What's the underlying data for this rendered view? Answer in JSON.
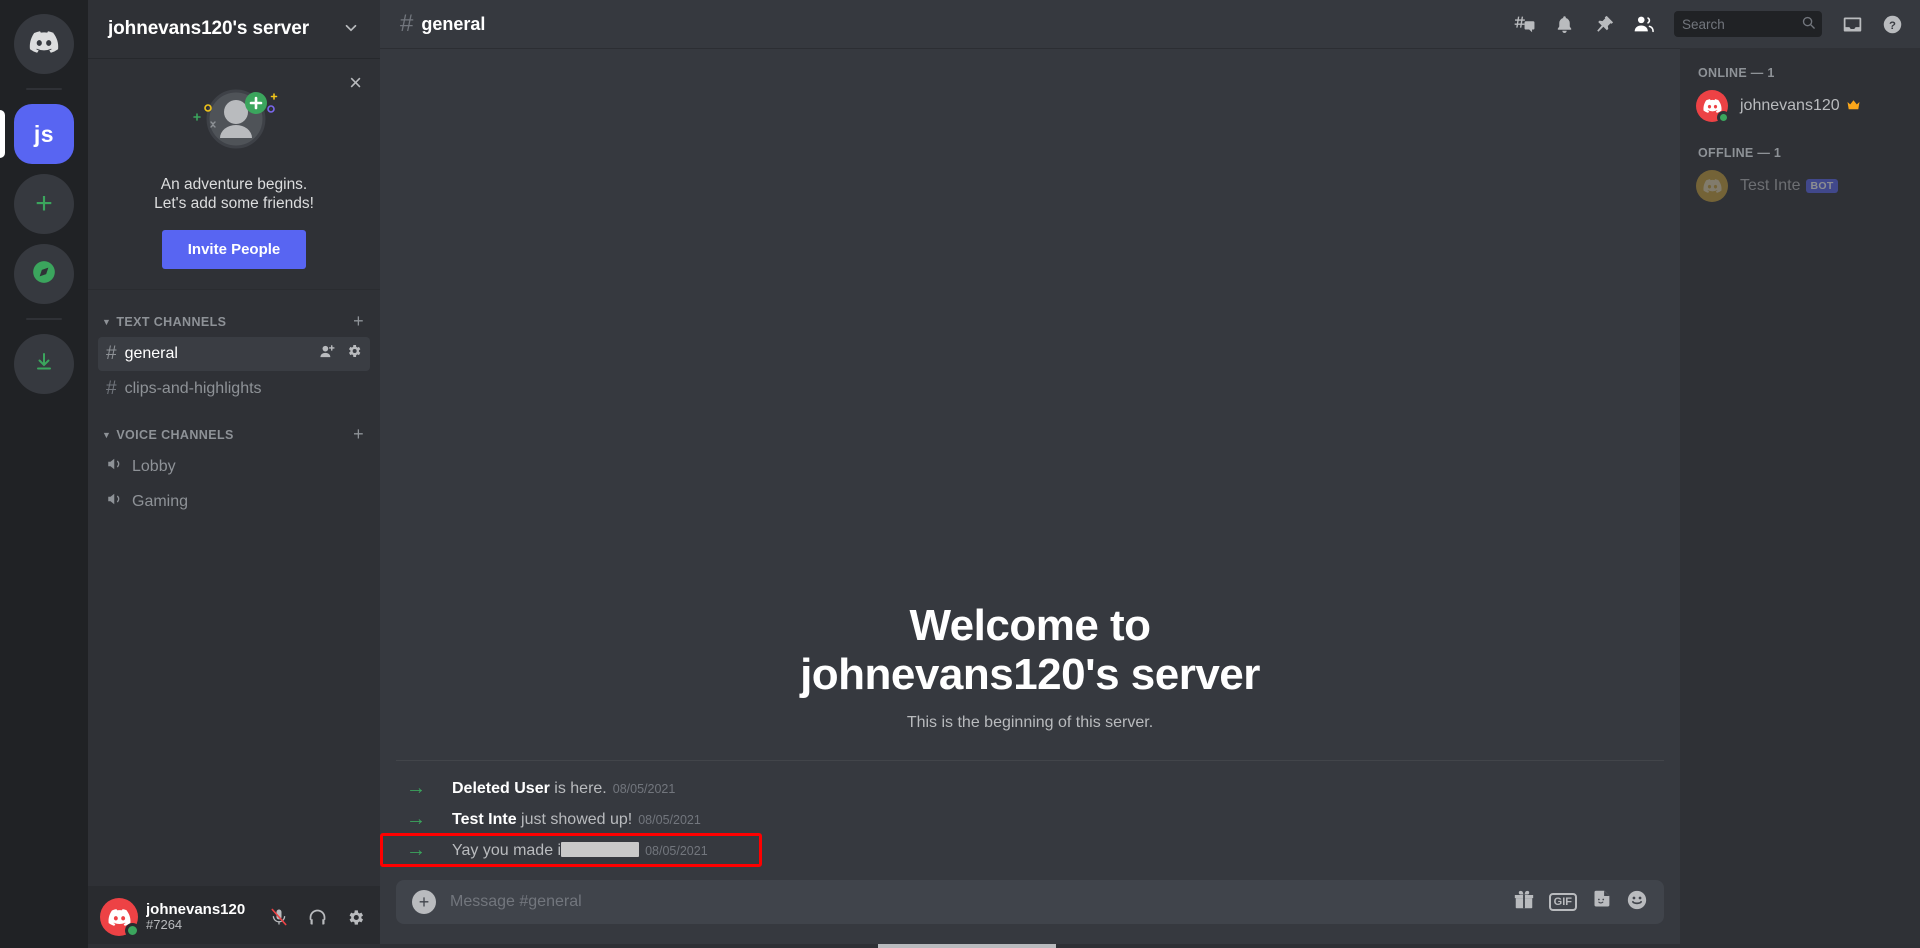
{
  "rail": {
    "items": [
      {
        "name": "discord-home",
        "label": "",
        "icon": "discord-logo-icon",
        "active": false
      },
      {
        "name": "server-js",
        "label": "js",
        "icon": "server-initials",
        "active": true
      },
      {
        "name": "add-server",
        "label": "+",
        "icon": "plus-icon",
        "active": false
      },
      {
        "name": "explore-servers",
        "label": "",
        "icon": "compass-icon",
        "active": false
      },
      {
        "name": "download-apps",
        "label": "",
        "icon": "download-icon",
        "active": false
      }
    ]
  },
  "sidebar": {
    "server_name": "johnevans120's server",
    "promo": {
      "line1": "An adventure begins.",
      "line2": "Let's add some friends!",
      "button": "Invite People",
      "close": "×"
    },
    "categories": [
      {
        "label": "TEXT CHANNELS",
        "plus": "+",
        "channels": [
          {
            "name": "general",
            "type": "text",
            "active": true
          },
          {
            "name": "clips-and-highlights",
            "type": "text",
            "active": false
          }
        ]
      },
      {
        "label": "VOICE CHANNELS",
        "plus": "+",
        "channels": [
          {
            "name": "Lobby",
            "type": "voice",
            "active": false
          },
          {
            "name": "Gaming",
            "type": "voice",
            "active": false
          }
        ]
      }
    ],
    "user": {
      "username": "johnevans120",
      "discriminator": "#7264",
      "status": "online",
      "controls": [
        "mic-muted-icon",
        "headphones-icon",
        "user-settings-gear-icon"
      ]
    }
  },
  "topbar": {
    "channel_name": "general",
    "hash": "#",
    "icons": [
      "threads-icon",
      "notification-bell-icon",
      "pinned-messages-icon",
      "member-list-icon"
    ],
    "search_placeholder": "Search",
    "right_icons": [
      "inbox-icon",
      "help-icon"
    ]
  },
  "main": {
    "welcome_line1": "Welcome to",
    "welcome_line2": "johnevans120's server",
    "subtitle": "This is the beginning of this server.",
    "system_messages": [
      {
        "actor": "Deleted User",
        "text": " is here.",
        "timestamp": "08/05/2021",
        "redacted": false,
        "highlighted": false
      },
      {
        "actor": "Test Inte",
        "text": " just showed up!",
        "timestamp": "08/05/2021",
        "redacted": false,
        "highlighted": false
      },
      {
        "actor": "",
        "text": "Yay you made i",
        "timestamp": "08/05/2021",
        "redacted": true,
        "highlighted": true
      }
    ],
    "composer_placeholder": "Message #general",
    "composer_icons": [
      "gift-icon",
      "gif-icon",
      "sticker-icon",
      "emoji-icon"
    ],
    "gif_label": "GIF"
  },
  "members": {
    "online_header": "ONLINE — 1",
    "offline_header": "OFFLINE — 1",
    "online": [
      {
        "name": "johnevans120",
        "owner": true,
        "bot": false
      }
    ],
    "offline": [
      {
        "name": "Test Inte",
        "owner": false,
        "bot": true,
        "bot_tag": "BOT"
      }
    ]
  },
  "colors": {
    "brand": "#5865f2",
    "online": "#3ba55d",
    "rail_bg": "#202225",
    "sidebar_bg": "#2f3136",
    "chat_bg": "#36393f",
    "highlight": "#ff0000",
    "crown": "#faa61a"
  }
}
